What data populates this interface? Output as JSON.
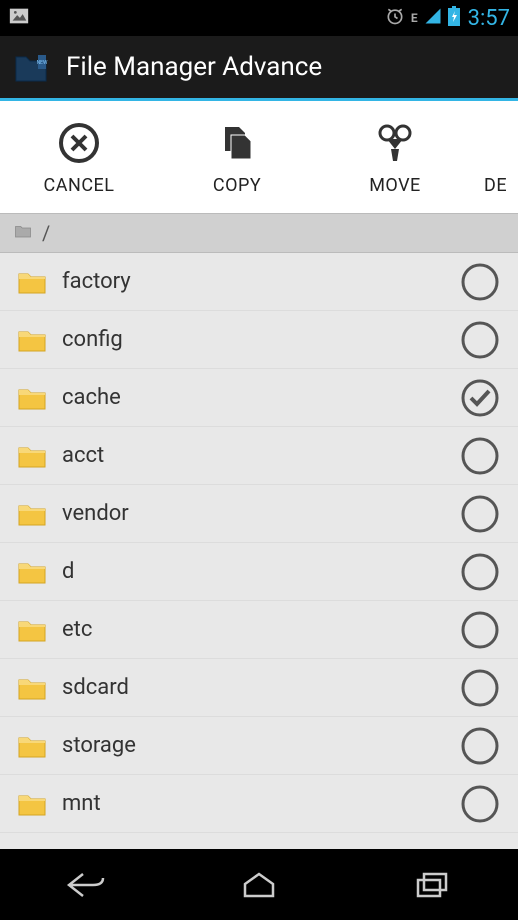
{
  "status": {
    "time": "3:57",
    "edge": "E"
  },
  "titlebar": {
    "title": "File Manager Advance"
  },
  "toolbar": {
    "cancel_label": "CANCEL",
    "copy_label": "COPY",
    "move_label": "MOVE",
    "delete_label": "DE"
  },
  "breadcrumb": {
    "path": "/"
  },
  "files": {
    "items": [
      {
        "name": "factory",
        "checked": false
      },
      {
        "name": "config",
        "checked": false
      },
      {
        "name": "cache",
        "checked": true
      },
      {
        "name": "acct",
        "checked": false
      },
      {
        "name": "vendor",
        "checked": false
      },
      {
        "name": "d",
        "checked": false
      },
      {
        "name": "etc",
        "checked": false
      },
      {
        "name": "sdcard",
        "checked": false
      },
      {
        "name": "storage",
        "checked": false
      },
      {
        "name": "mnt",
        "checked": false
      }
    ]
  }
}
